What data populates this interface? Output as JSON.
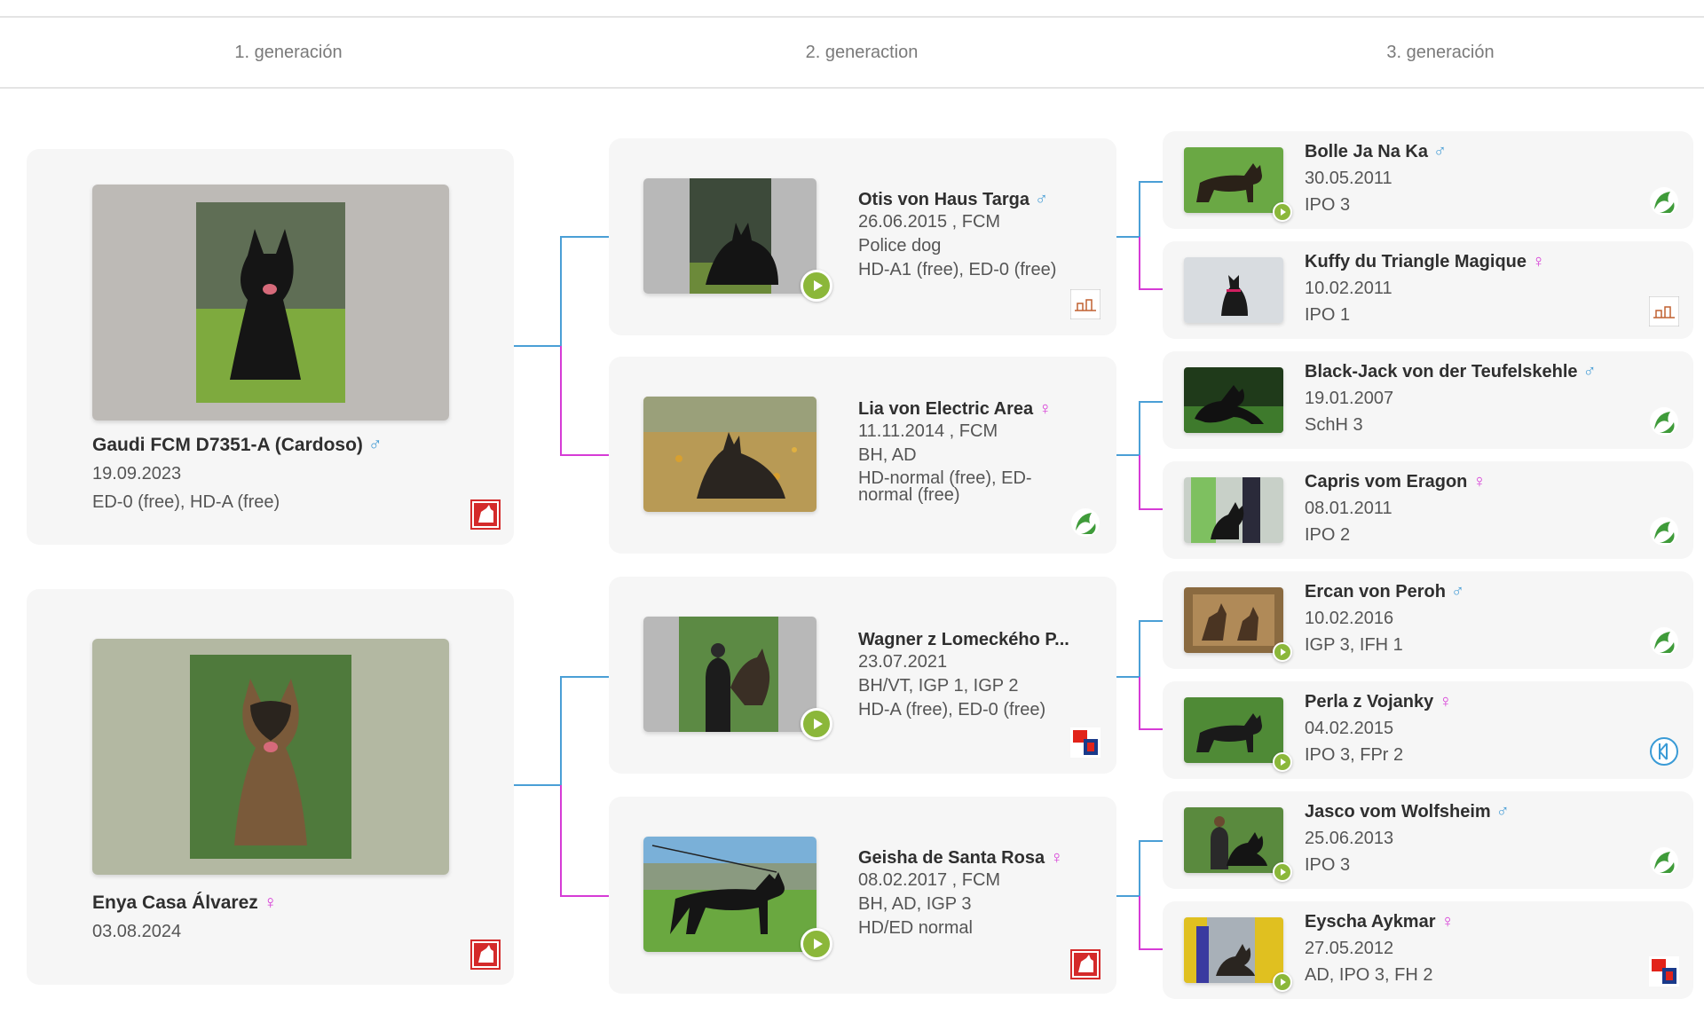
{
  "generations": [
    "1. generación",
    "2. generaction",
    "3. generación"
  ],
  "gen1": [
    {
      "name": "Gaudi FCM D7351-A (Cardoso)",
      "sex": "♂",
      "line1": "19.09.2023",
      "line2": "ED-0 (free), HD-A (free)",
      "logo": "breed-club-logo-red"
    },
    {
      "name": "Enya Casa Álvarez",
      "sex": "♀",
      "line1": "03.08.2024",
      "line2": "",
      "logo": "breed-club-logo-red"
    }
  ],
  "gen2": [
    {
      "name": "Otis von Haus Targa",
      "sex": "♂",
      "line1": "26.06.2015 , FCM",
      "line2": "Police dog",
      "line3": "HD-A1 (free), ED-0 (free)",
      "logo": "register-logo-sketch"
    },
    {
      "name": "Lia von Electric Area",
      "sex": "♀",
      "line1": "11.11.2014 , FCM",
      "line2": "BH, AD",
      "line3": "HD-normal (free), ED-normal (free)",
      "logo": "green-leaf-logo"
    },
    {
      "name": "Wagner z Lomeckého P...",
      "sex": "",
      "line1": "23.07.2021",
      "line2": "BH/VT, IGP 1, IGP 2",
      "line3": "HD-A (free), ED-0 (free)",
      "logo": "cmkc-logo"
    },
    {
      "name": "Geisha de Santa Rosa",
      "sex": "♀",
      "line1": "08.02.2017 , FCM",
      "line2": "BH, AD, IGP 3",
      "line3": "HD/ED normal",
      "logo": "breed-club-logo-red"
    }
  ],
  "gen3": [
    {
      "name": "Bolle Ja Na Ka",
      "sex": "♂",
      "line1": "30.05.2011",
      "line2": "IPO 3",
      "logo": "green-leaf-logo"
    },
    {
      "name": "Kuffy du Triangle Magique",
      "sex": "♀",
      "line1": "10.02.2011",
      "line2": "IPO 1",
      "logo": "register-logo-sketch"
    },
    {
      "name": "Black-Jack von der Teufelskehle",
      "sex": "♂",
      "line1": "19.01.2007",
      "line2": "SchH 3",
      "logo": "green-leaf-logo"
    },
    {
      "name": "Capris vom Eragon",
      "sex": "♀",
      "line1": "08.01.2011",
      "line2": "IPO 2",
      "logo": "green-leaf-logo"
    },
    {
      "name": "Ercan von Peroh",
      "sex": "♂",
      "line1": "10.02.2016",
      "line2": "IGP 3, IFH 1",
      "logo": "green-leaf-logo"
    },
    {
      "name": "Perla z Vojanky",
      "sex": "♀",
      "line1": "04.02.2015",
      "line2": "IPO 3, FPr 2",
      "logo": "kk-circle-logo"
    },
    {
      "name": "Jasco vom Wolfsheim",
      "sex": "♂",
      "line1": "25.06.2013",
      "line2": "IPO 3",
      "logo": "green-leaf-logo"
    },
    {
      "name": "Eyscha Aykmar",
      "sex": "♀",
      "line1": "27.05.2012",
      "line2": "AD, IPO 3, FH 2",
      "logo": "cmkc-logo"
    }
  ],
  "colors": {
    "male_line": "#4a9fd6",
    "female_line": "#d63bd6",
    "play": "#8bb73a",
    "card_bg": "#f6f6f6"
  }
}
